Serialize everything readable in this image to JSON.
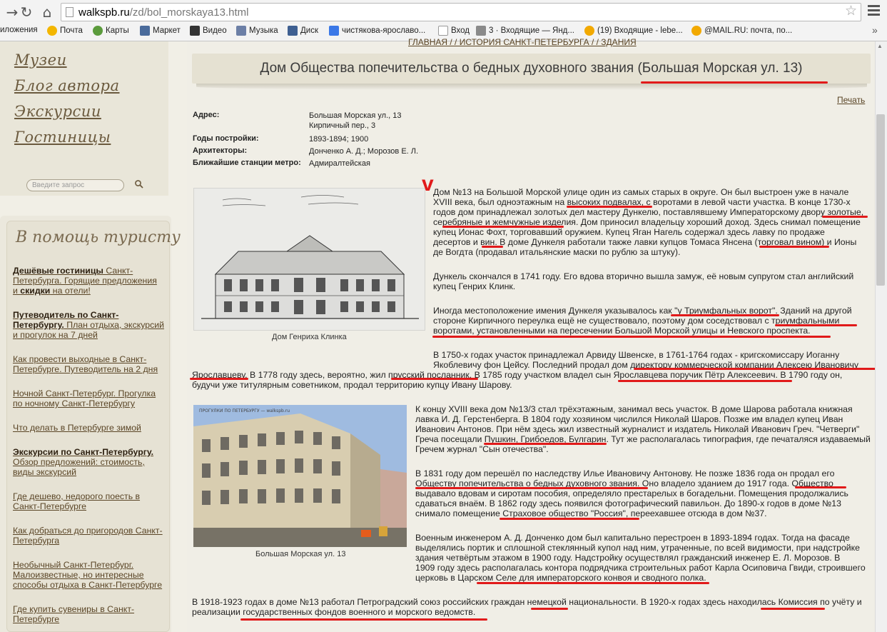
{
  "browser": {
    "url_host": "walkspb.ru",
    "url_path": "/zd/bol_morskaya13.html",
    "bookmarks": [
      "иложения",
      "Почта",
      "Карты",
      "Маркет",
      "Видео",
      "Музыка",
      "Диск",
      "чистякова-ярославо...",
      "Вход",
      "3 · Входящие — Янд...",
      "(19) Входящие - lebe...",
      "@MAIL.RU: почта, по..."
    ],
    "more": "»"
  },
  "sidebar": {
    "script_links": [
      "Музеи",
      "Блог автора",
      "Экскурсии",
      "Гостиницы"
    ],
    "search_placeholder": "Введите запрос",
    "tourist_title": "В помощь туристу",
    "links": [
      {
        "bold": "Дешёвые гостиницы",
        "rest": " Санкт-Петербурга. Горящие предложения и ",
        "bold2": "скидки",
        "rest2": " на отели!"
      },
      {
        "bold": "Путеводитель по Санкт-Петербургу.",
        "rest": " План отдыха, экскурсий и прогулок на 7 дней",
        "bold2": "",
        "rest2": ""
      },
      {
        "bold": "",
        "rest": "Как провести выходные в Санкт-Петербурге. Путеводитель на 2 дня",
        "bold2": "",
        "rest2": ""
      },
      {
        "bold": "",
        "rest": "Ночной Санкт-Петербург. Прогулка по ночному Санкт-Петербургу",
        "bold2": "",
        "rest2": ""
      },
      {
        "bold": "",
        "rest": "Что делать в Петербурге зимой",
        "bold2": "",
        "rest2": ""
      },
      {
        "bold": "Экскурсии по Санкт-Петербургу.",
        "rest": " Обзор предложений: стоимость, виды экскурсий",
        "bold2": "",
        "rest2": ""
      },
      {
        "bold": "",
        "rest": "Где дешево, недорого поесть в Санкт-Петербурге",
        "bold2": "",
        "rest2": ""
      },
      {
        "bold": "",
        "rest": "Как добраться до пригородов Санкт-Петербурга",
        "bold2": "",
        "rest2": ""
      },
      {
        "bold": "",
        "rest": "Необычный Санкт-Петербург. Малоизвестные, но интересные способы отдыха в Санкт-Петербурге",
        "bold2": "",
        "rest2": ""
      },
      {
        "bold": "",
        "rest": "Где купить сувениры в Санкт-Петербурге",
        "bold2": "",
        "rest2": ""
      }
    ]
  },
  "article": {
    "crumbs": "ГЛАВНАЯ / / ИСТОРИЯ САНКТ-ПЕТЕРБУРГА / / ЗДАНИЯ",
    "title": "Дом Общества попечительства о бедных духовного звания (Большая Морская ул. 13)",
    "print": "Печать",
    "info": [
      {
        "label": "Адрес:",
        "value_line1": "Большая Морская ул., 13",
        "value_line2": "Кирпичный пер., 3"
      },
      {
        "label": "Годы постройки:",
        "value_line1": "1893-1894; 1900",
        "value_line2": ""
      },
      {
        "label": "Архитекторы:",
        "value_line1": "Донченко А. Д.; Морозов Е. Л.",
        "value_line2": ""
      },
      {
        "label": "Ближайшие станции метро:",
        "value_line1": "Адмиралтейская",
        "value_line2": ""
      }
    ],
    "caption1": "Дом Генриха Клинка",
    "caption2": "Большая Морская ул. 13",
    "photo_watermark": "ПРОГУЛКИ ПО ПЕТЕРБУРГУ — walkspb.ru",
    "p1": [
      "Дом №13 на Большой Морской улице один из самых старых в округе. Он был выстроен уже в начале",
      "XVIII века, был одноэтажным на высоких подвалах, с воротами в левой части участка. В конце 1730-х",
      "годов дом принадлежал золотых дел мастеру Дункелю, поставлявшему Императорскому двору золотые,",
      "серебряные и жемчужные изделия. Дом приносил владельцу хороший доход. Здесь снимал помещение",
      "купец Ионас Фохт, торговавший оружием. Купец Яган Нагель содержал здесь лавку по продаже",
      "десертов и вин. В доме Дункеля работали также лавки купцов Томаса Янсена (торговал вином) и Ионы",
      "де Вогдта (продавал итальянские маски по рублю за штуку)."
    ],
    "p2": [
      "Дункель скончался в 1741 году. Его вдова вторично вышла замуж, её новым супругом стал английский",
      "купец Генрих Клинк."
    ],
    "p3": [
      "Иногда местоположение имения Дункеля указывалось как \"у Триумфальных ворот\". Зданий на другой",
      "стороне Кирпичного переулка ещё не существовало, поэтому дом соседствовал с триумфальными",
      "воротами, установленными на пересечении Большой Морской улицы и Невского проспекта."
    ],
    "p4": [
      "В 1750-х годах участок принадлежал Арвиду Швенске, в 1761-1764 годах - кригскомиссару Иоганну",
      "Якоблевичу фон Цейсу. Последний продал дом директору коммерческой компании Алексею Ивановичу"
    ],
    "p4b": [
      "Ярославцеву. В 1778 году здесь, вероятно, жил прусский посланник. В 1785 году участком владел сын Ярославцева поручик Пётр Алексеевич. В 1790 году он,",
      "будучи уже титулярным советником, продал территорию купцу Ивану Шарову."
    ],
    "p5": [
      "К концу XVIII века дом №13/3 стал трёхэтажным, занимал весь участок. В доме Шарова работала книжная",
      "лавка И. Д. Герстенберга. В 1804 году хозяином числился Николай Шаров. Позже им владел купец Иван",
      "Иванович Антонов. При нём здесь жил известный журналист и издатель Николай Иванович Греч. \"Четверги\"",
      "Греча посещали Пушкин, Грибоедов, Булгарин. Тут же располагалась типография, где печаталяся издаваемый",
      "Гречем журнал \"Сын отечества\"."
    ],
    "p6": [
      "В 1831 году дом перешёл по наследству Илье Ивановичу Антонову. Не позже 1836 года он продал его",
      "Обществу попечительства о бедных духовного звания. Оно владело зданием до 1917 года. Общество",
      "выдавало вдовам и сиротам пособия, определяло престарелых в богадельни. Помещения продолжались",
      "сдаваться внаём. В 1862 году здесь появился фотографический павильон. До 1890-х годов в доме №13",
      "снимало помещение Страховое общество \"Россия\", переехавшее отсюда в дом №37."
    ],
    "p7": [
      "Военным инженером А. Д. Донченко дом был капитально перестроен в 1893-1894 годах. Тогда на фасаде",
      "выделялись портик и сплошной стеклянный купол над ним, утраченные, по всей видимости, при надстройке",
      "здания четвёртым этажом в 1900 году. Надстройку осуществлял гражданский инженер Е. Л. Морозов. В",
      "1909 году здесь располагалась контора подрядчика строительных работ Карла Осиповича Гвиди, строившего",
      "церковь в Царском Селе для императорского конвоя и сводного полка."
    ],
    "p8": [
      "В 1918-1923 годах в доме №13 работал Петроградский союз российских граждан немецкой национальности. В 1920-х годах здесь находилась Комиссия по учёту и",
      "реализации государственных фондов военного и морского ведомств."
    ]
  },
  "colors": {
    "annotation_red": "#e11a1a",
    "link_brown": "#5a4526",
    "title_bar": "#e5e1d2"
  }
}
